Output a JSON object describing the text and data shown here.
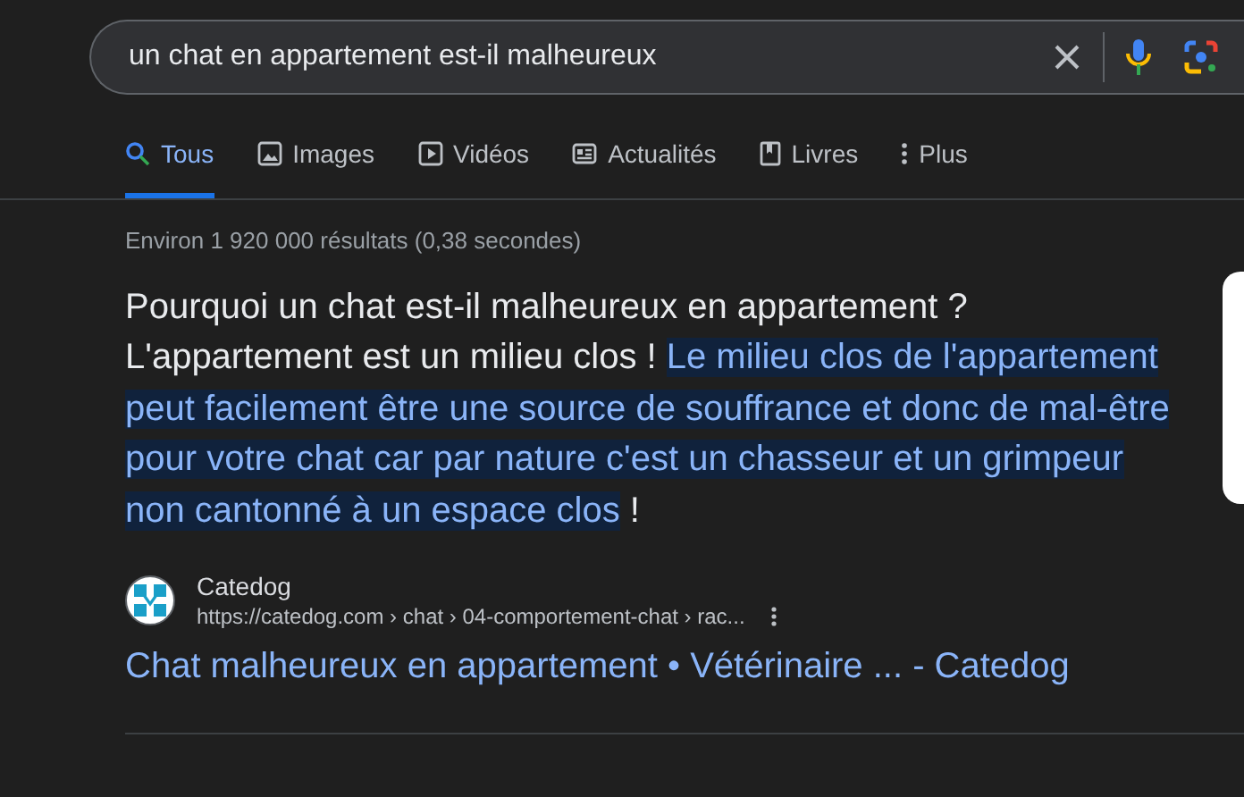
{
  "search": {
    "value": "un chat en appartement est-il malheureux"
  },
  "tabs": [
    {
      "label": "Tous",
      "selected": true
    },
    {
      "label": "Images",
      "selected": false
    },
    {
      "label": "Vidéos",
      "selected": false
    },
    {
      "label": "Actualités",
      "selected": false
    },
    {
      "label": "Livres",
      "selected": false
    },
    {
      "label": "Plus",
      "selected": false
    }
  ],
  "result_stats": "Environ 1 920 000 résultats (0,38 secondes)",
  "answer": {
    "heading": "Pourquoi un chat est-il malheureux en appartement ?",
    "lead": "L'appartement est un milieu clos ! ",
    "highlight": "Le milieu clos de l'appartement peut facilement être une source de souffrance et donc de mal-être pour votre chat car par nature c'est un chasseur et un grimpeur non cantonné à un espace clos",
    "tail": " !"
  },
  "source": {
    "name": "Catedog",
    "url": "https://catedog.com › chat › 04-comportement-chat › rac...",
    "title": "Chat malheureux en appartement • Vétérinaire ... - Catedog"
  }
}
